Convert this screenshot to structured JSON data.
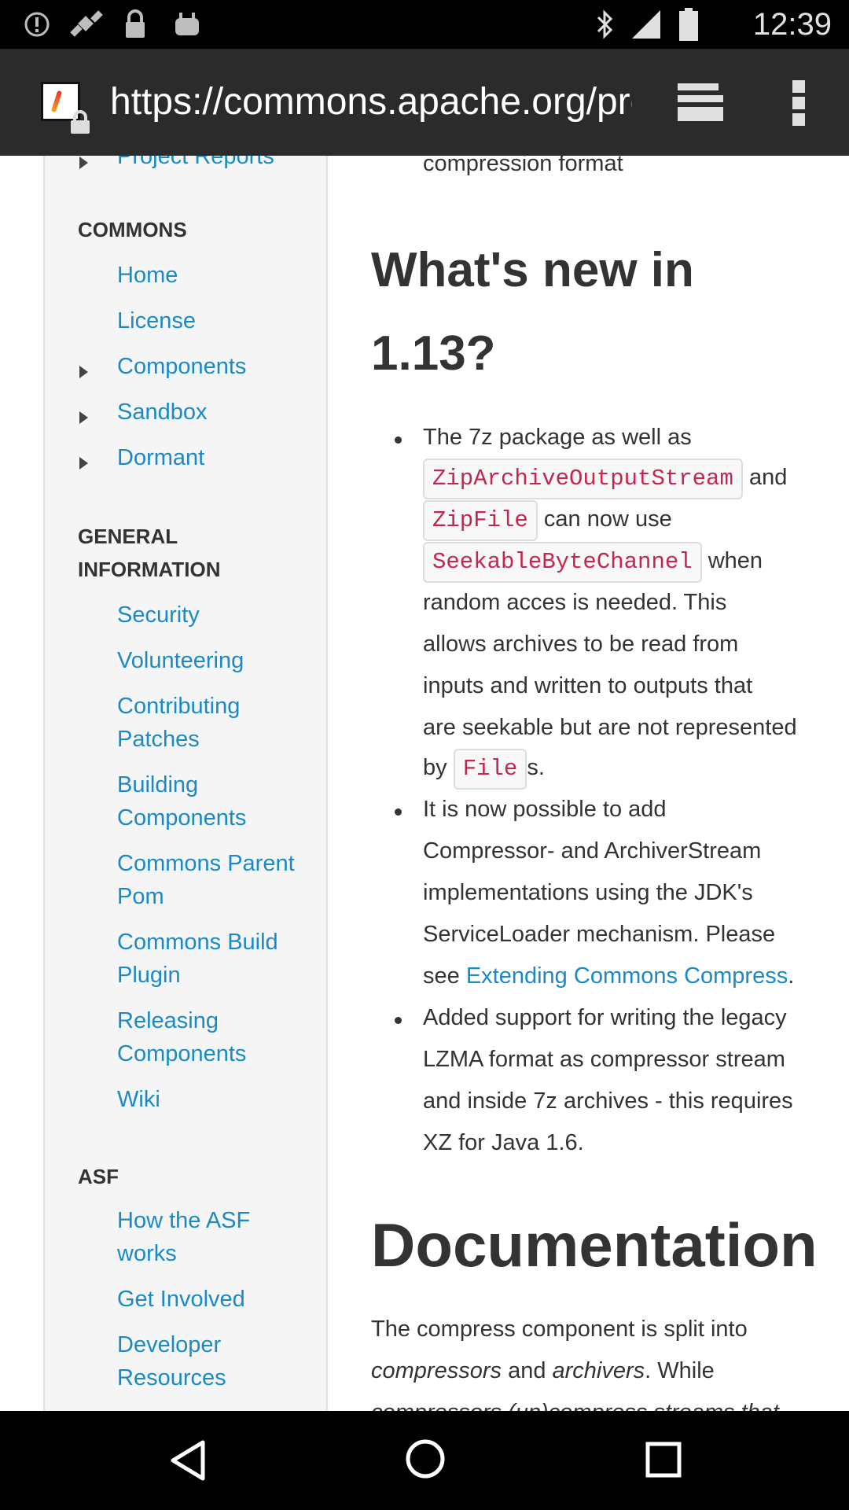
{
  "status_bar": {
    "time": "12:39",
    "icons": [
      "alert-icon",
      "satellite-icon",
      "lock-icon",
      "android-icon",
      "bluetooth-icon",
      "signal-icon",
      "battery-icon"
    ]
  },
  "browser": {
    "url": "https://commons.apache.org/proper/commons-compress/",
    "icons": [
      "site-favicon",
      "lock-icon",
      "tabs-icon",
      "overflow-menu-icon"
    ]
  },
  "sidebar": {
    "partial_item": "Project Reports",
    "sections": [
      {
        "heading": "COMMONS",
        "items": [
          "Home",
          "License",
          "Components",
          "Sandbox",
          "Dormant"
        ]
      },
      {
        "heading": "GENERAL INFORMATION",
        "items": [
          "Security",
          "Volunteering",
          "Contributing Patches",
          "Building Components",
          "Commons Parent Pom",
          "Commons Build Plugin",
          "Releasing Components",
          "Wiki"
        ]
      },
      {
        "heading": "ASF",
        "items": [
          "How the ASF works",
          "Get Involved",
          "Developer Resources"
        ]
      }
    ]
  },
  "content": {
    "partial_line": "compression format",
    "whats_new_heading_1": "What's new in",
    "whats_new_heading_2": "1.13?",
    "b1": {
      "t1": "The 7z package as well as",
      "c1": "ZipArchiveOutputStream",
      "t2": "and",
      "c2": "ZipFile",
      "t3": "can now use",
      "c3": "SeekableByteChannel",
      "t4": "when",
      "t5": "random acces is needed. This",
      "t6": "allows archives to be read from",
      "t7": "inputs and written to outputs that",
      "t8": "are seekable but are not represented",
      "t9": "by",
      "c4": "File",
      "t10": "s."
    },
    "b2": {
      "t1": "It is now possible to add",
      "t2": "Compressor- and ArchiverStream",
      "t3": "implementations using the JDK's",
      "t4": "ServiceLoader mechanism. Please",
      "t5": "see",
      "link": "Extending Commons Compress",
      "t6": "."
    },
    "b3": {
      "t1": "Added support for writing the legacy",
      "t2": "LZMA format as compressor stream",
      "t3": "and inside 7z archives - this requires",
      "t4": "XZ for Java 1.6."
    },
    "documentation_heading": "Documentation",
    "doc": {
      "t1": "The compress component is split into",
      "em1": "compressors",
      "t2": "and",
      "em2": "archivers",
      "t3": ". While",
      "partial": "compressors (un)compress streams that"
    }
  },
  "nav_bar": {
    "icons": [
      "back-icon",
      "home-icon",
      "recents-icon"
    ]
  }
}
